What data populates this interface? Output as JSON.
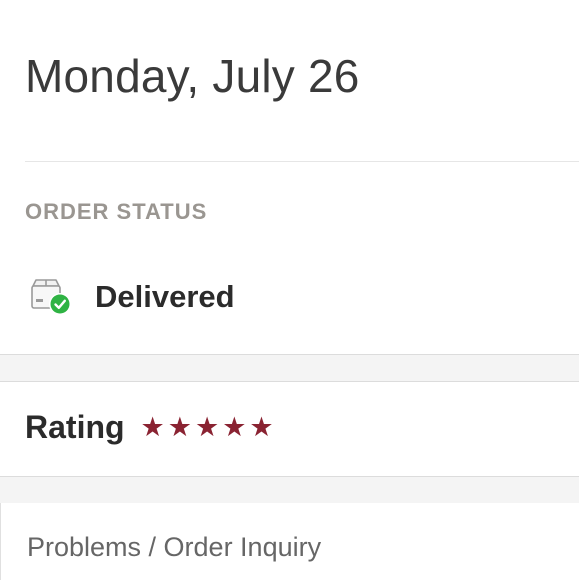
{
  "order": {
    "date": "Monday, July 26",
    "status_label": "ORDER STATUS",
    "status_value": "Delivered",
    "status_icon": "package-delivered-icon",
    "status_color": "#2fb344"
  },
  "rating": {
    "label": "Rating",
    "stars": 5,
    "max_stars": 5,
    "star_color": "#8a2332"
  },
  "inquiry": {
    "label": "Problems / Order Inquiry"
  }
}
